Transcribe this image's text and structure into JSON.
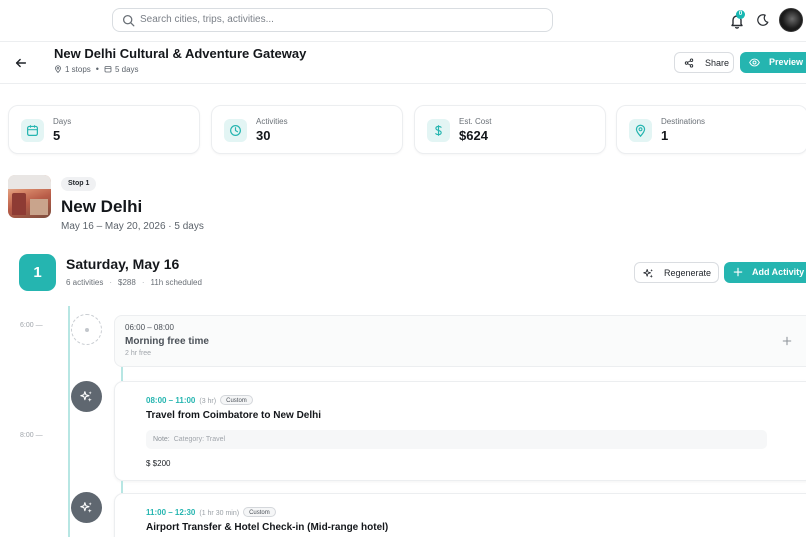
{
  "header": {
    "search_placeholder": "Search cities, trips, activities...",
    "notification_count": "0"
  },
  "trip": {
    "title": "New Delhi Cultural & Adventure Gateway",
    "stops": "1 stops",
    "days": "5 days",
    "share_label": "Share",
    "preview_label": "Preview"
  },
  "stats": [
    {
      "label": "Days",
      "value": "5",
      "icon": "calendar-icon"
    },
    {
      "label": "Activities",
      "value": "30",
      "icon": "clock-icon"
    },
    {
      "label": "Est. Cost",
      "value": "$624",
      "icon": "dollar-icon"
    },
    {
      "label": "Destinations",
      "value": "1",
      "icon": "map-pin-icon"
    }
  ],
  "stop": {
    "badge": "Stop 1",
    "city": "New Delhi",
    "dates": "May 16 – May 20, 2026 · 5 days"
  },
  "day": {
    "number": "1",
    "title": "Saturday, May 16",
    "activities": "6 activities",
    "cost": "$288",
    "scheduled": "11h scheduled",
    "regenerate_label": "Regenerate",
    "add_activity_label": "Add Activity"
  },
  "timeline": {
    "labels": [
      "6:00 —",
      "8:00 —"
    ],
    "free_slot": {
      "time": "06:00 – 08:00",
      "name": "Morning free time",
      "duration": "2 hr free"
    },
    "activities": [
      {
        "time": "08:00 – 11:00",
        "duration": "(3 hr)",
        "tag": "Custom",
        "name": "Travel from Coimbatore to New Delhi",
        "note_label": "Note:",
        "note": "Category: Travel",
        "cost": "$200"
      },
      {
        "time": "11:00 – 12:30",
        "duration": "(1 hr 30 min)",
        "tag": "Custom",
        "name": "Airport Transfer & Hotel Check-in (Mid-range hotel)"
      }
    ]
  },
  "colors": {
    "accent": "#25b5b0",
    "accent_light": "#e3f5f4",
    "node_dark": "#5f6770"
  }
}
